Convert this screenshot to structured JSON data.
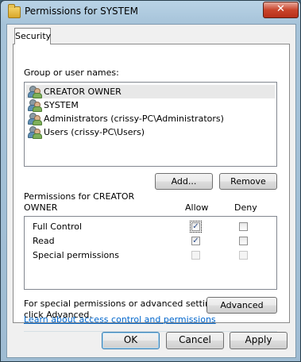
{
  "window": {
    "title": "Permissions for SYSTEM",
    "close_symbol": "✕"
  },
  "tabs": [
    {
      "label": "Security"
    }
  ],
  "group_section": {
    "label": "Group or user names:",
    "users": [
      {
        "name": "CREATOR OWNER",
        "icon": "users-icon",
        "selected": true
      },
      {
        "name": "SYSTEM",
        "icon": "users-icon",
        "selected": false
      },
      {
        "name": "Administrators (crissy-PC\\Administrators)",
        "icon": "users-icon",
        "selected": false
      },
      {
        "name": "Users (crissy-PC\\Users)",
        "icon": "users-icon",
        "selected": false
      }
    ],
    "add_label": "Add...",
    "remove_label": "Remove"
  },
  "permissions_section": {
    "label_line1": "Permissions for CREATOR",
    "label_line2": "OWNER",
    "allow_header": "Allow",
    "deny_header": "Deny",
    "rows": [
      {
        "name": "Full Control",
        "allow": true,
        "deny": false,
        "enabled": true
      },
      {
        "name": "Read",
        "allow": true,
        "deny": false,
        "enabled": true
      },
      {
        "name": "Special permissions",
        "allow": false,
        "deny": false,
        "enabled": false
      }
    ]
  },
  "advanced_section": {
    "text_line1": "For special permissions or advanced settings,",
    "text_line2": "click Advanced.",
    "advanced_label": "Advanced"
  },
  "help_link": "Learn about access control and permissions",
  "buttons": {
    "ok": "OK",
    "cancel": "Cancel",
    "apply": "Apply"
  },
  "check_mark": "✓"
}
